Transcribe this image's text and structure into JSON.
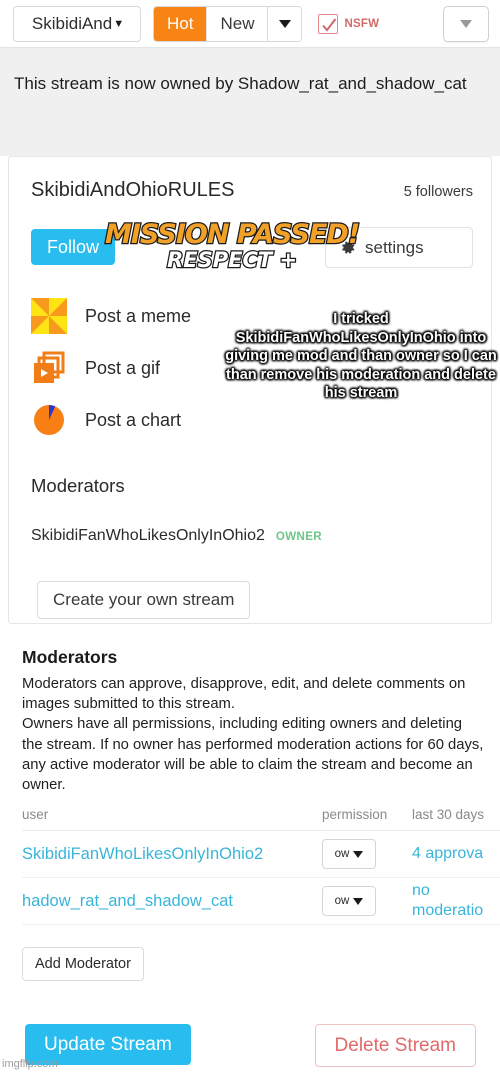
{
  "toolbar": {
    "stream_select_value": "SkibidiAnd",
    "caret_glyph": "▼",
    "hot_label": "Hot",
    "new_label": "New",
    "nsfw_label": "NSFW",
    "accent_orange": "#f78414",
    "nsfw_color": "#d16a6a"
  },
  "notice": {
    "text": "This stream is now owned by\nShadow_rat_and_shadow_cat"
  },
  "card": {
    "stream_title": "SkibidiAndOhioRULES",
    "followers": "5 followers",
    "follow_label": "Follow",
    "settings_label": "settings",
    "post_items": [
      {
        "label": "Post a meme",
        "icon": "pinwheel-icon"
      },
      {
        "label": "Post a gif",
        "icon": "gif-frames-icon"
      },
      {
        "label": "Post a chart",
        "icon": "pie-chart-icon"
      }
    ],
    "moderators_heading": "Moderators",
    "moderator_name": "SkibidiFanWhoLikesOnlyInOhio2",
    "owner_badge": "OWNER",
    "create_stream_label": "Create your own stream",
    "follow_color": "#29bdef",
    "owner_badge_color": "#6ec688"
  },
  "lower": {
    "title": "Moderators",
    "description": "Moderators can approve, disapprove, edit, and delete comments on images submitted to this stream.\nOwners have all permissions, including editing owners and deleting the stream. If no owner has performed moderation actions for 60 days, any active moderator will be able to claim the stream and become an owner.",
    "columns": {
      "user": "user",
      "permission": "permission",
      "last30": "last 30 days"
    },
    "rows": [
      {
        "user": "SkibidiFanWhoLikesOnlyInOhio2",
        "permission": "ow",
        "last30": "4 approva"
      },
      {
        "user": "hadow_rat_and_shadow_cat",
        "permission": "ow",
        "last30": "no moderatio"
      }
    ],
    "add_moderator_label": "Add Moderator",
    "update_label": "Update Stream",
    "delete_label": "Delete Stream",
    "link_color": "#39b5da",
    "delete_color": "#e06a6a"
  },
  "overlay": {
    "gta_line1": "MISSION PASSED!",
    "gta_line2": "RESPECT +",
    "caption": "I tricked SkibidiFanWhoLikesOnlyInOhio into giving me mod and than owner so I can than remove his moderation and delete his stream",
    "gta_color": "#f2a128"
  },
  "watermark": "imgflip.com"
}
